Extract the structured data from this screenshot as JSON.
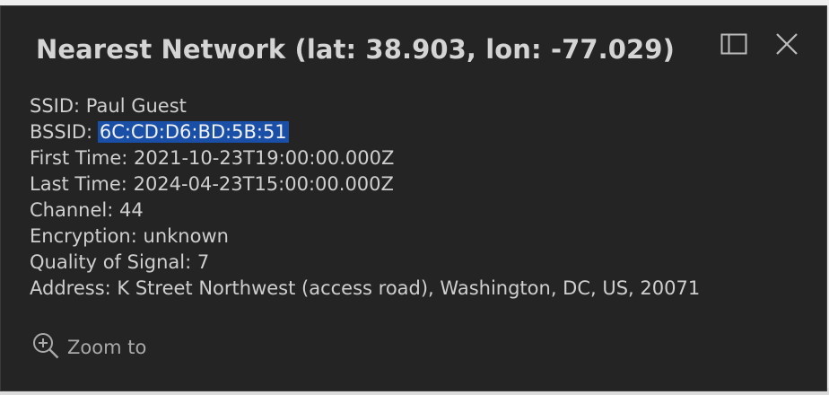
{
  "popup": {
    "title": "Nearest Network (lat: 38.903, lon: -77.029)",
    "fields": {
      "ssid_label": "SSID:",
      "ssid_value": "Paul Guest",
      "bssid_label": "BSSID:",
      "bssid_value": "6C:CD:D6:BD:5B:51",
      "first_time_label": "First Time:",
      "first_time_value": "2021-10-23T19:00:00.000Z",
      "last_time_label": "Last Time:",
      "last_time_value": "2024-04-23T15:00:00.000Z",
      "channel_label": "Channel:",
      "channel_value": "44",
      "encryption_label": "Encryption:",
      "encryption_value": "unknown",
      "quality_label": "Quality of Signal:",
      "quality_value": "7",
      "address_label": "Address:",
      "address_value": "K Street Northwest (access road), Washington, DC, US, 20071"
    },
    "actions": {
      "zoom_label": "Zoom to"
    },
    "icons": {
      "dock": "dock-panel-icon",
      "close": "close-icon",
      "zoom": "zoom-in-icon"
    },
    "colors": {
      "background": "#242424",
      "text": "#cfcfcf",
      "selection": "#1a4fa8"
    }
  }
}
